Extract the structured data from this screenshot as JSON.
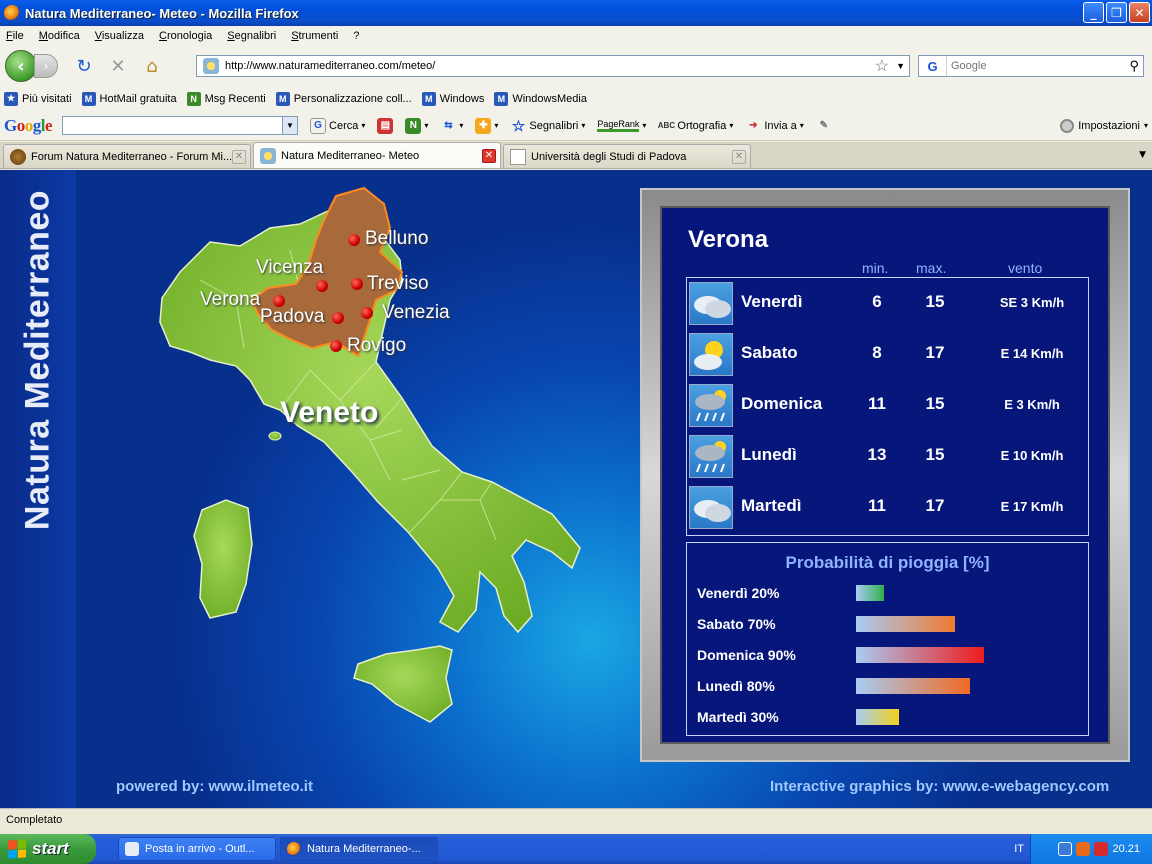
{
  "window": {
    "title": "Natura Mediterraneo- Meteo - Mozilla Firefox"
  },
  "menu": [
    "File",
    "Modifica",
    "Visualizza",
    "Cronologia",
    "Segnalibri",
    "Strumenti",
    "?"
  ],
  "nav": {
    "url": "http://www.naturamediterraneo.com/meteo/",
    "search_placeholder": "Google"
  },
  "bookmarks": [
    "Più visitati",
    "HotMail gratuita",
    "Msg Recenti",
    "Personalizzazione coll...",
    "Windows",
    "WindowsMedia"
  ],
  "google_toolbar": {
    "logo": "Google",
    "search": "Cerca",
    "bookmarks": "Segnalibri",
    "pagerank": "PageRank",
    "spell": "Ortografia",
    "send": "Invia a",
    "settings": "Impostazioni"
  },
  "tabs": [
    {
      "label": "Forum Natura Mediterraneo - Forum Mi...",
      "active": false
    },
    {
      "label": "Natura Mediterraneo- Meteo",
      "active": true
    },
    {
      "label": "Università degli Studi di Padova",
      "active": false
    }
  ],
  "page": {
    "site_title": "Natura Mediterraneo",
    "region": "Veneto",
    "cities": [
      "Belluno",
      "Vicenza",
      "Treviso",
      "Verona",
      "Padova",
      "Venezia",
      "Rovigo"
    ],
    "powered_by": "powered by: www.ilmeteo.it",
    "credits": "Interactive graphics by: www.e-webagency.com"
  },
  "forecast": {
    "city": "Verona",
    "headers": {
      "min": "min.",
      "max": "max.",
      "wind": "vento"
    },
    "days": [
      {
        "day": "Venerdì",
        "min": "6",
        "max": "15",
        "wind": "SE  3 Km/h",
        "icon": "cloudy-icon"
      },
      {
        "day": "Sabato",
        "min": "8",
        "max": "17",
        "wind": "E  14 Km/h",
        "icon": "sun-cloud-icon"
      },
      {
        "day": "Domenica",
        "min": "11",
        "max": "15",
        "wind": "E  3 Km/h",
        "icon": "rain-icon"
      },
      {
        "day": "Lunedì",
        "min": "13",
        "max": "15",
        "wind": "E  10 Km/h",
        "icon": "rain-icon"
      },
      {
        "day": "Martedì",
        "min": "11",
        "max": "17",
        "wind": "E  17 Km/h",
        "icon": "cloudy-icon"
      }
    ],
    "rain_title": "Probabilità di pioggia [%]",
    "rain": [
      {
        "label": "Venerdì 20%",
        "percent": 20,
        "color": "#2fb04a"
      },
      {
        "label": "Sabato 70%",
        "percent": 70,
        "color": "#f07a30"
      },
      {
        "label": "Domenica 90%",
        "percent": 90,
        "color": "#ee1c1c"
      },
      {
        "label": "Lunedì 80%",
        "percent": 80,
        "color": "#f06a24"
      },
      {
        "label": "Martedì 30%",
        "percent": 30,
        "color": "#f2d21a"
      }
    ]
  },
  "status": "Completato",
  "taskbar": {
    "start": "start",
    "tasks": [
      {
        "label": "Posta in arrivo - Outl...",
        "active": false
      },
      {
        "label": "Natura Mediterraneo-...",
        "active": true
      }
    ],
    "lang": "IT",
    "clock": "20.21"
  }
}
